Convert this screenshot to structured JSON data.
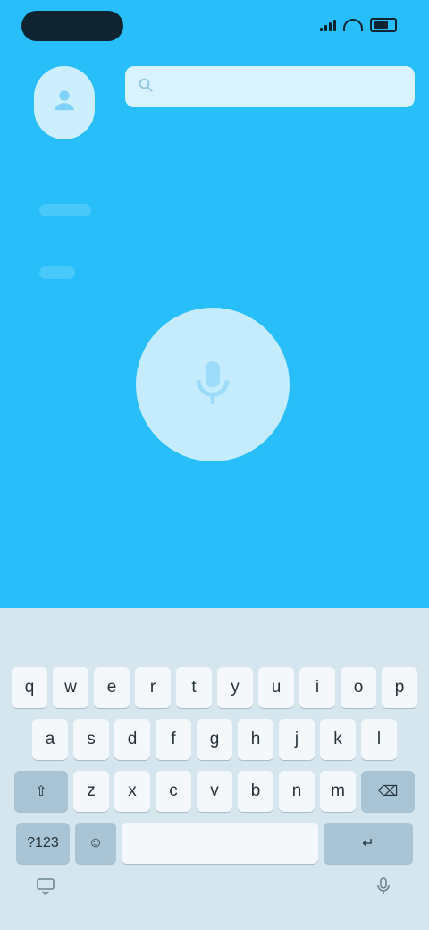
{
  "status_bar": {
    "time": "",
    "icons": [
      "signal-icon",
      "wifi-icon",
      "battery-icon"
    ]
  },
  "header": {
    "avatar_icon": "user-icon",
    "search": {
      "placeholder": "",
      "value": "",
      "icon": "search-icon"
    }
  },
  "main": {
    "mic_icon": "mic-icon"
  },
  "keyboard": {
    "suggestions": [
      "",
      "",
      ""
    ],
    "row1": [
      "q",
      "w",
      "e",
      "r",
      "t",
      "y",
      "u",
      "i",
      "o",
      "p"
    ],
    "row2": [
      "a",
      "s",
      "d",
      "f",
      "g",
      "h",
      "j",
      "k",
      "l"
    ],
    "row3_left": "⇧",
    "row3": [
      "z",
      "x",
      "c",
      "v",
      "b",
      "n",
      "m"
    ],
    "row3_right": "⌫",
    "row4_left": "?123",
    "row4_emoji": "☺",
    "space_label": "",
    "row4_right": "↵"
  },
  "nav": {
    "left_icon": "keyboard-down-icon",
    "right_icon": "mic-icon"
  },
  "colors": {
    "app_background": "#27BEF9",
    "keyboard_background": "#D6E6EF",
    "mic_button": "#C4ECFD"
  }
}
